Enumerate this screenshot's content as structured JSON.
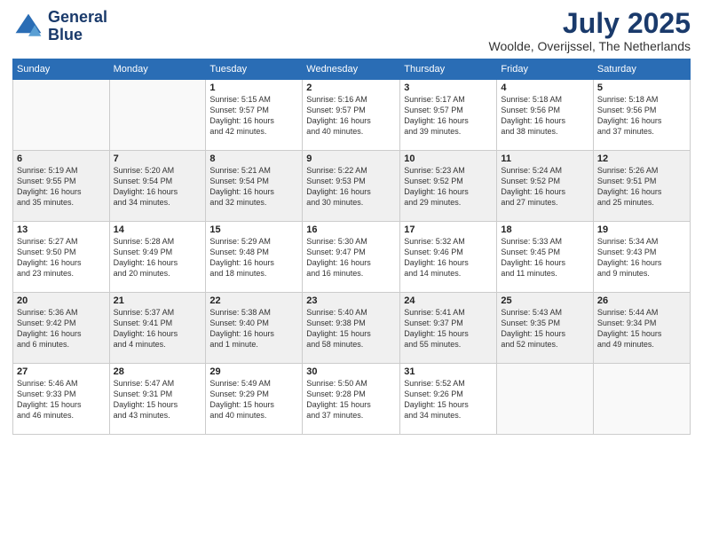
{
  "logo": {
    "line1": "General",
    "line2": "Blue"
  },
  "title": "July 2025",
  "location": "Woolde, Overijssel, The Netherlands",
  "days_of_week": [
    "Sunday",
    "Monday",
    "Tuesday",
    "Wednesday",
    "Thursday",
    "Friday",
    "Saturday"
  ],
  "weeks": [
    [
      {
        "num": "",
        "info": ""
      },
      {
        "num": "",
        "info": ""
      },
      {
        "num": "1",
        "info": "Sunrise: 5:15 AM\nSunset: 9:57 PM\nDaylight: 16 hours\nand 42 minutes."
      },
      {
        "num": "2",
        "info": "Sunrise: 5:16 AM\nSunset: 9:57 PM\nDaylight: 16 hours\nand 40 minutes."
      },
      {
        "num": "3",
        "info": "Sunrise: 5:17 AM\nSunset: 9:57 PM\nDaylight: 16 hours\nand 39 minutes."
      },
      {
        "num": "4",
        "info": "Sunrise: 5:18 AM\nSunset: 9:56 PM\nDaylight: 16 hours\nand 38 minutes."
      },
      {
        "num": "5",
        "info": "Sunrise: 5:18 AM\nSunset: 9:56 PM\nDaylight: 16 hours\nand 37 minutes."
      }
    ],
    [
      {
        "num": "6",
        "info": "Sunrise: 5:19 AM\nSunset: 9:55 PM\nDaylight: 16 hours\nand 35 minutes."
      },
      {
        "num": "7",
        "info": "Sunrise: 5:20 AM\nSunset: 9:54 PM\nDaylight: 16 hours\nand 34 minutes."
      },
      {
        "num": "8",
        "info": "Sunrise: 5:21 AM\nSunset: 9:54 PM\nDaylight: 16 hours\nand 32 minutes."
      },
      {
        "num": "9",
        "info": "Sunrise: 5:22 AM\nSunset: 9:53 PM\nDaylight: 16 hours\nand 30 minutes."
      },
      {
        "num": "10",
        "info": "Sunrise: 5:23 AM\nSunset: 9:52 PM\nDaylight: 16 hours\nand 29 minutes."
      },
      {
        "num": "11",
        "info": "Sunrise: 5:24 AM\nSunset: 9:52 PM\nDaylight: 16 hours\nand 27 minutes."
      },
      {
        "num": "12",
        "info": "Sunrise: 5:26 AM\nSunset: 9:51 PM\nDaylight: 16 hours\nand 25 minutes."
      }
    ],
    [
      {
        "num": "13",
        "info": "Sunrise: 5:27 AM\nSunset: 9:50 PM\nDaylight: 16 hours\nand 23 minutes."
      },
      {
        "num": "14",
        "info": "Sunrise: 5:28 AM\nSunset: 9:49 PM\nDaylight: 16 hours\nand 20 minutes."
      },
      {
        "num": "15",
        "info": "Sunrise: 5:29 AM\nSunset: 9:48 PM\nDaylight: 16 hours\nand 18 minutes."
      },
      {
        "num": "16",
        "info": "Sunrise: 5:30 AM\nSunset: 9:47 PM\nDaylight: 16 hours\nand 16 minutes."
      },
      {
        "num": "17",
        "info": "Sunrise: 5:32 AM\nSunset: 9:46 PM\nDaylight: 16 hours\nand 14 minutes."
      },
      {
        "num": "18",
        "info": "Sunrise: 5:33 AM\nSunset: 9:45 PM\nDaylight: 16 hours\nand 11 minutes."
      },
      {
        "num": "19",
        "info": "Sunrise: 5:34 AM\nSunset: 9:43 PM\nDaylight: 16 hours\nand 9 minutes."
      }
    ],
    [
      {
        "num": "20",
        "info": "Sunrise: 5:36 AM\nSunset: 9:42 PM\nDaylight: 16 hours\nand 6 minutes."
      },
      {
        "num": "21",
        "info": "Sunrise: 5:37 AM\nSunset: 9:41 PM\nDaylight: 16 hours\nand 4 minutes."
      },
      {
        "num": "22",
        "info": "Sunrise: 5:38 AM\nSunset: 9:40 PM\nDaylight: 16 hours\nand 1 minute."
      },
      {
        "num": "23",
        "info": "Sunrise: 5:40 AM\nSunset: 9:38 PM\nDaylight: 15 hours\nand 58 minutes."
      },
      {
        "num": "24",
        "info": "Sunrise: 5:41 AM\nSunset: 9:37 PM\nDaylight: 15 hours\nand 55 minutes."
      },
      {
        "num": "25",
        "info": "Sunrise: 5:43 AM\nSunset: 9:35 PM\nDaylight: 15 hours\nand 52 minutes."
      },
      {
        "num": "26",
        "info": "Sunrise: 5:44 AM\nSunset: 9:34 PM\nDaylight: 15 hours\nand 49 minutes."
      }
    ],
    [
      {
        "num": "27",
        "info": "Sunrise: 5:46 AM\nSunset: 9:33 PM\nDaylight: 15 hours\nand 46 minutes."
      },
      {
        "num": "28",
        "info": "Sunrise: 5:47 AM\nSunset: 9:31 PM\nDaylight: 15 hours\nand 43 minutes."
      },
      {
        "num": "29",
        "info": "Sunrise: 5:49 AM\nSunset: 9:29 PM\nDaylight: 15 hours\nand 40 minutes."
      },
      {
        "num": "30",
        "info": "Sunrise: 5:50 AM\nSunset: 9:28 PM\nDaylight: 15 hours\nand 37 minutes."
      },
      {
        "num": "31",
        "info": "Sunrise: 5:52 AM\nSunset: 9:26 PM\nDaylight: 15 hours\nand 34 minutes."
      },
      {
        "num": "",
        "info": ""
      },
      {
        "num": "",
        "info": ""
      }
    ]
  ]
}
